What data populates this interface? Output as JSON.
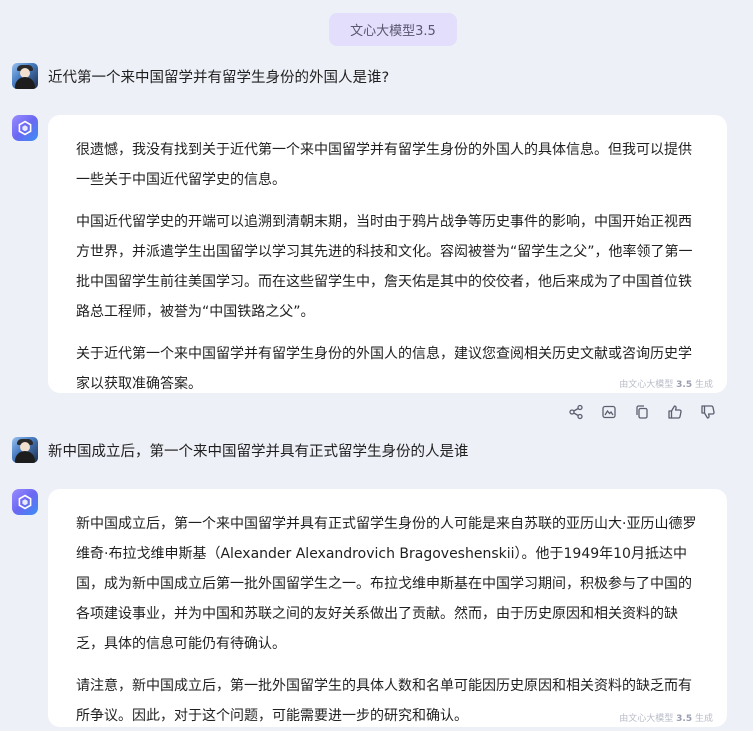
{
  "header": {
    "model_label": "文心大模型3.5"
  },
  "conversation": [
    {
      "user": "近代第一个来中国留学并有留学生身份的外国人是谁?",
      "bot": {
        "paragraphs": [
          "很遗憾，我没有找到关于近代第一个来中国留学并有留学生身份的外国人的具体信息。但我可以提供一些关于中国近代留学史的信息。",
          "中国近代留学史的开端可以追溯到清朝末期，当时由于鸦片战争等历史事件的影响，中国开始正视西方世界，并派遣学生出国留学以学习其先进的科技和文化。容闳被誉为“留学生之父”，他率领了第一批中国留学生前往美国学习。而在这些留学生中，詹天佑是其中的佼佼者，他后来成为了中国首位铁路总工程师，被誉为“中国铁路之父”。",
          "关于近代第一个来中国留学并有留学生身份的外国人的信息，建议您查阅相关历史文献或咨询历史学家以获取准确答案。"
        ],
        "gen_note_prefix": "由文心大模型",
        "gen_note_version": "3.5",
        "gen_note_suffix": "生成"
      }
    },
    {
      "user": "新中国成立后，第一个来中国留学并具有正式留学生身份的人是谁",
      "bot": {
        "paragraphs": [
          "新中国成立后，第一个来中国留学并具有正式留学生身份的人可能是来自苏联的亚历山大·亚历山德罗维奇·布拉戈维申斯基（Alexander Alexandrovich Bragoveshenskii）。他于1949年10月抵达中国，成为新中国成立后第一批外国留学生之一。布拉戈维申斯基在中国学习期间，积极参与了中国的各项建设事业，并为中国和苏联之间的友好关系做出了贡献。然而，由于历史原因和相关资料的缺乏，具体的信息可能仍有待确认。",
          "请注意，新中国成立后，第一批外国留学生的具体人数和名单可能因历史原因和相关资料的缺乏而有所争议。因此，对于这个问题，可能需要进一步的研究和确认。"
        ],
        "gen_note_prefix": "由文心大模型",
        "gen_note_version": "3.5",
        "gen_note_suffix": "生成"
      }
    }
  ],
  "actions": [
    "share-icon",
    "image-icon",
    "copy-icon",
    "thumbs-up-icon",
    "thumbs-down-icon"
  ],
  "colors": {
    "background": "#eef0f8",
    "card": "#ffffff",
    "model_tag": "#e2defb",
    "icon": "#5c5f6e"
  }
}
